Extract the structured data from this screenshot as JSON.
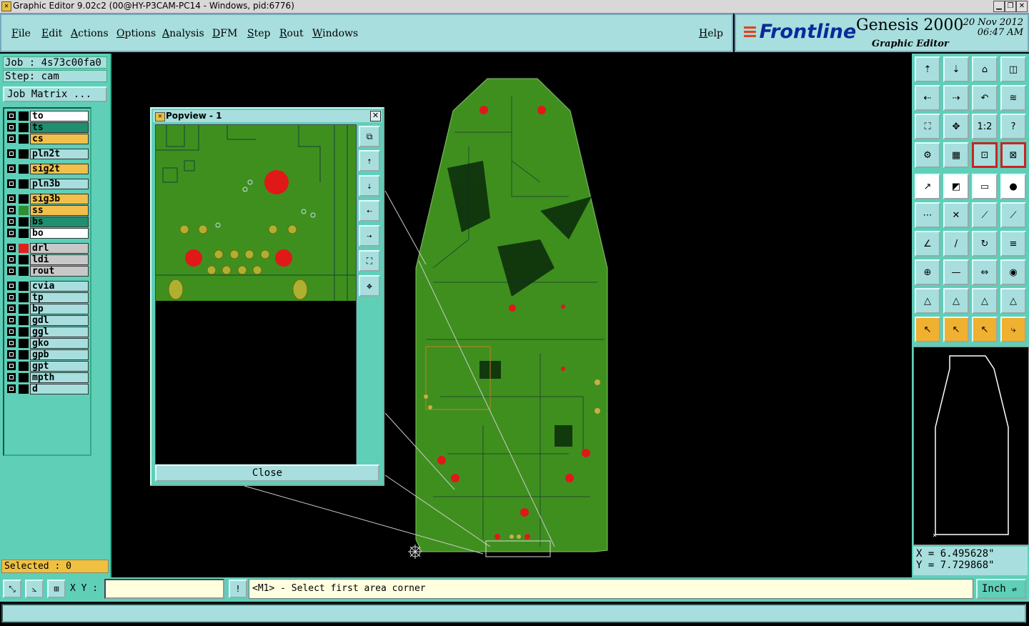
{
  "window": {
    "title": "Graphic Editor 9.02c2 (00@HY-P3CAM-PC14 - Windows, pid:6776)"
  },
  "menu": {
    "items": [
      "File",
      "Edit",
      "Actions",
      "Options",
      "Analysis",
      "DFM",
      "Step",
      "Rout",
      "Windows"
    ],
    "help": "Help"
  },
  "brand": {
    "logo": "Frontline",
    "product": "Genesis 2000",
    "subtitle": "Graphic Editor",
    "date": "20 Nov 2012",
    "time": "06:47 AM"
  },
  "job": {
    "job_line": "Job : 4s73c00fa0",
    "step_line": "Step: cam",
    "matrix_button": "Job Matrix ..."
  },
  "layers": [
    {
      "name": "to",
      "color": "#ffffff",
      "swatch": "#000000"
    },
    {
      "name": "ts",
      "color": "#1f8f6f",
      "swatch": "#000000"
    },
    {
      "name": "cs",
      "color": "#f2c04a",
      "swatch": "#000000"
    },
    {
      "name": "pln2t",
      "color": "#a8dede",
      "swatch": "#000000"
    },
    {
      "name": "sig2t",
      "color": "#f2c04a",
      "swatch": "#000000"
    },
    {
      "name": "pln3b",
      "color": "#a8dede",
      "swatch": "#000000"
    },
    {
      "name": "sig3b",
      "color": "#f2c04a",
      "swatch": "#000000"
    },
    {
      "name": "ss",
      "color": "#f2c04a",
      "swatch": "#2f8f2f"
    },
    {
      "name": "bs",
      "color": "#1f8f6f",
      "swatch": "#000000"
    },
    {
      "name": "bo",
      "color": "#ffffff",
      "swatch": "#000000"
    },
    {
      "name": "drl",
      "color": "#c8c8c8",
      "swatch": "#e02020"
    },
    {
      "name": "ldi",
      "color": "#c8c8c8",
      "swatch": "#000000"
    },
    {
      "name": "rout",
      "color": "#c8c8c8",
      "swatch": "#000000"
    },
    {
      "name": "cvia",
      "color": "#a8dede",
      "swatch": "#000000"
    },
    {
      "name": "tp",
      "color": "#a8dede",
      "swatch": "#000000"
    },
    {
      "name": "bp",
      "color": "#a8dede",
      "swatch": "#000000"
    },
    {
      "name": "gdl",
      "color": "#a8dede",
      "swatch": "#000000"
    },
    {
      "name": "ggl",
      "color": "#a8dede",
      "swatch": "#000000"
    },
    {
      "name": "gko",
      "color": "#a8dede",
      "swatch": "#000000"
    },
    {
      "name": "gpb",
      "color": "#a8dede",
      "swatch": "#000000"
    },
    {
      "name": "gpt",
      "color": "#a8dede",
      "swatch": "#000000"
    },
    {
      "name": "mpth",
      "color": "#a8dede",
      "swatch": "#000000"
    },
    {
      "name": "d",
      "color": "#a8dede",
      "swatch": "#000000"
    }
  ],
  "selected": "Selected : 0",
  "popview": {
    "title": "Popview - 1",
    "close_button": "Close"
  },
  "coordinates": {
    "x": "X =  6.495628\"",
    "y": "Y =  7.729868\""
  },
  "bottom": {
    "xy_label": "X Y :",
    "xy_value": "",
    "message": "<M1> - Select first area corner",
    "unit": "Inch"
  },
  "toolbar_icons": [
    "layer-up-icon",
    "layer-down-icon",
    "home-icon",
    "window-split-icon",
    "pan-left-icon",
    "pan-right-icon",
    "undo-zoom-icon",
    "redraw-icon",
    "zoom-fit-icon",
    "zoom-center-icon",
    "zoom-1to2-icon",
    "help-icon",
    "settings-icon",
    "grid-icon",
    "snap-icon",
    "snap-off-icon",
    "add-feature-icon",
    "delete-icon",
    "ruler-icon",
    "pad-icon",
    "connect-icon",
    "cross-icon",
    "line-node-icon",
    "arc-node-icon",
    "angle-icon",
    "slash-icon",
    "arc-icon",
    "text-icon",
    "move-node-icon",
    "minus-icon",
    "dimension-icon",
    "shapes-icon",
    "triangle-add-icon",
    "triangle-icon",
    "triangle-up-icon",
    "triangle-cut-icon",
    "select-pointer-icon",
    "select-box-icon",
    "select-pointer-alt-icon",
    "route-icon"
  ],
  "colors": {
    "panel": "#5fcfb8",
    "field": "#a8dede",
    "board": "#3f8f1f",
    "pad": "#e01818"
  }
}
